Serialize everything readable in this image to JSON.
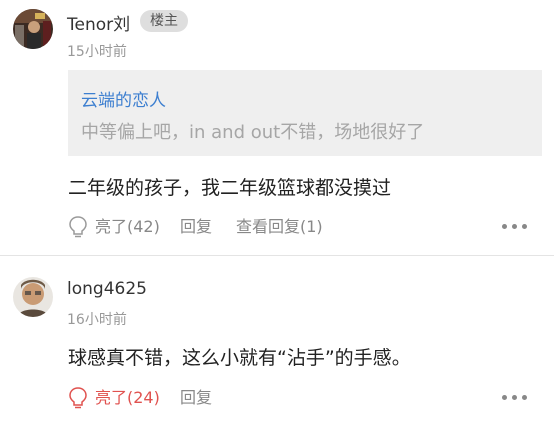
{
  "comments": [
    {
      "username": "Tenor刘",
      "badge": "楼主",
      "time": "15小时前",
      "quote": {
        "author": "云端的恋人",
        "text": "中等偏上吧，in and out不错，场地很好了"
      },
      "content": "二年级的孩子，我二年级篮球都没摸过",
      "actions": {
        "like": "亮了(42)",
        "reply": "回复",
        "view_replies": "查看回复(1)"
      },
      "liked": false
    },
    {
      "username": "long4625",
      "time": "16小时前",
      "content": "球感真不错，这么小就有“沾手”的手感。",
      "actions": {
        "like": "亮了(24)",
        "reply": "回复"
      },
      "liked": true
    }
  ],
  "colors": {
    "link": "#3d7fd0",
    "liked": "#e0524f",
    "muted": "#999999"
  },
  "icons": {
    "like": "lightbulb-icon",
    "more": "more-dots-icon"
  }
}
